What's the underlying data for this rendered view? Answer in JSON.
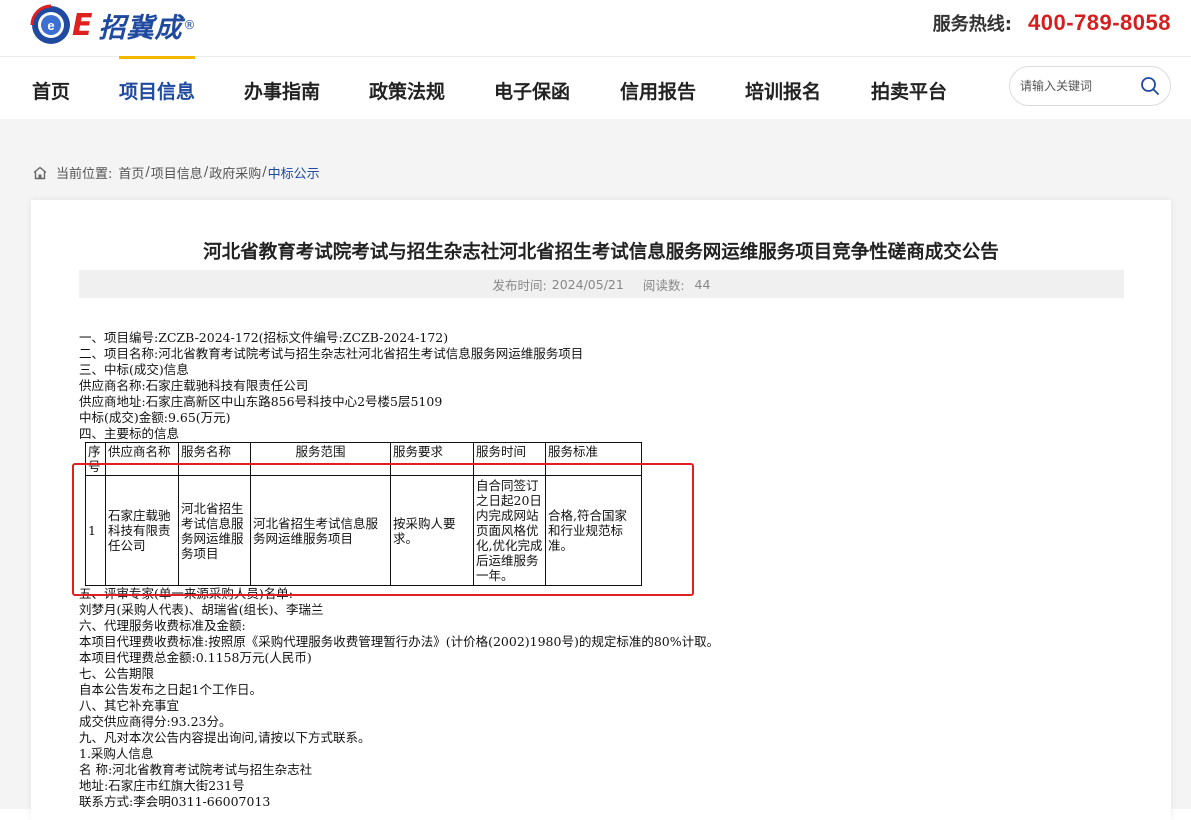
{
  "header": {
    "logo_text": "招冀成",
    "logo_reg": "®",
    "hotline_label": "服务热线:",
    "hotline_number": "400-789-8058"
  },
  "nav": {
    "items": [
      {
        "label": "首页"
      },
      {
        "label": "项目信息"
      },
      {
        "label": "办事指南"
      },
      {
        "label": "政策法规"
      },
      {
        "label": "电子保函"
      },
      {
        "label": "信用报告"
      },
      {
        "label": "培训报名"
      },
      {
        "label": "拍卖平台"
      }
    ],
    "active_index": 1
  },
  "search": {
    "placeholder": "请输入关键词",
    "icon": "search-icon"
  },
  "breadcrumb": {
    "prefix": "当前位置:",
    "items": [
      "首页",
      "项目信息",
      "政府采购"
    ],
    "current": "中标公示"
  },
  "article": {
    "title": "河北省教育考试院考试与招生杂志社河北省招生考试信息服务网运维服务项目竞争性磋商成交公告",
    "publish_label": "发布时间:",
    "publish_date": "2024/05/21",
    "reads_label": "阅读数:",
    "reads_count": "44",
    "lines_top": [
      "一、项目编号:ZCZB-2024-172(招标文件编号:ZCZB-2024-172)",
      "二、项目名称:河北省教育考试院考试与招生杂志社河北省招生考试信息服务网运维服务项目",
      "三、中标(成交)信息",
      "供应商名称:石家庄载驰科技有限责任公司",
      "供应商地址:石家庄高新区中山东路856号科技中心2号楼5层5109",
      "中标(成交)金额:9.65(万元)",
      "四、主要标的信息"
    ],
    "table": {
      "headers": [
        "序号",
        "供应商名称",
        "服务名称",
        "服务范围",
        "服务要求",
        "服务时间",
        "服务标准"
      ],
      "row": [
        "1",
        "石家庄载驰科技有限责任公司",
        "河北省招生考试信息服务网运维服务项目",
        "河北省招生考试信息服务网运维服务项目",
        "按采购人要求。",
        "自合同签订之日起20日内完成网站页面风格优化,优化完成后运维服务一年。",
        "合格,符合国家和行业规范标准。"
      ]
    },
    "lines_bottom": [
      "五、评审专家(单一来源采购人员)名单:",
      "刘梦月(采购人代表)、胡瑞省(组长)、李瑞兰",
      "六、代理服务收费标准及金额:",
      "本项目代理费收费标准:按照原《采购代理服务收费管理暂行办法》(计价格(2002)1980号)的规定标准的80%计取。",
      "本项目代理费总金额:0.1158万元(人民币)",
      "七、公告期限",
      "自本公告发布之日起1个工作日。",
      "八、其它补充事宜",
      "成交供应商得分:93.23分。",
      "九、凡对本次公告内容提出询问,请按以下方式联系。",
      "1.采购人信息",
      "名 称:河北省教育考试院考试与招生杂志社",
      "地址:石家庄市红旗大街231号",
      "联系方式:李会明0311-66007013"
    ]
  },
  "colors": {
    "brand_blue": "#1f4aa0",
    "hotline_red": "#d51f1f",
    "highlight_red": "#e02020",
    "nav_active_bar": "#f5b800"
  }
}
